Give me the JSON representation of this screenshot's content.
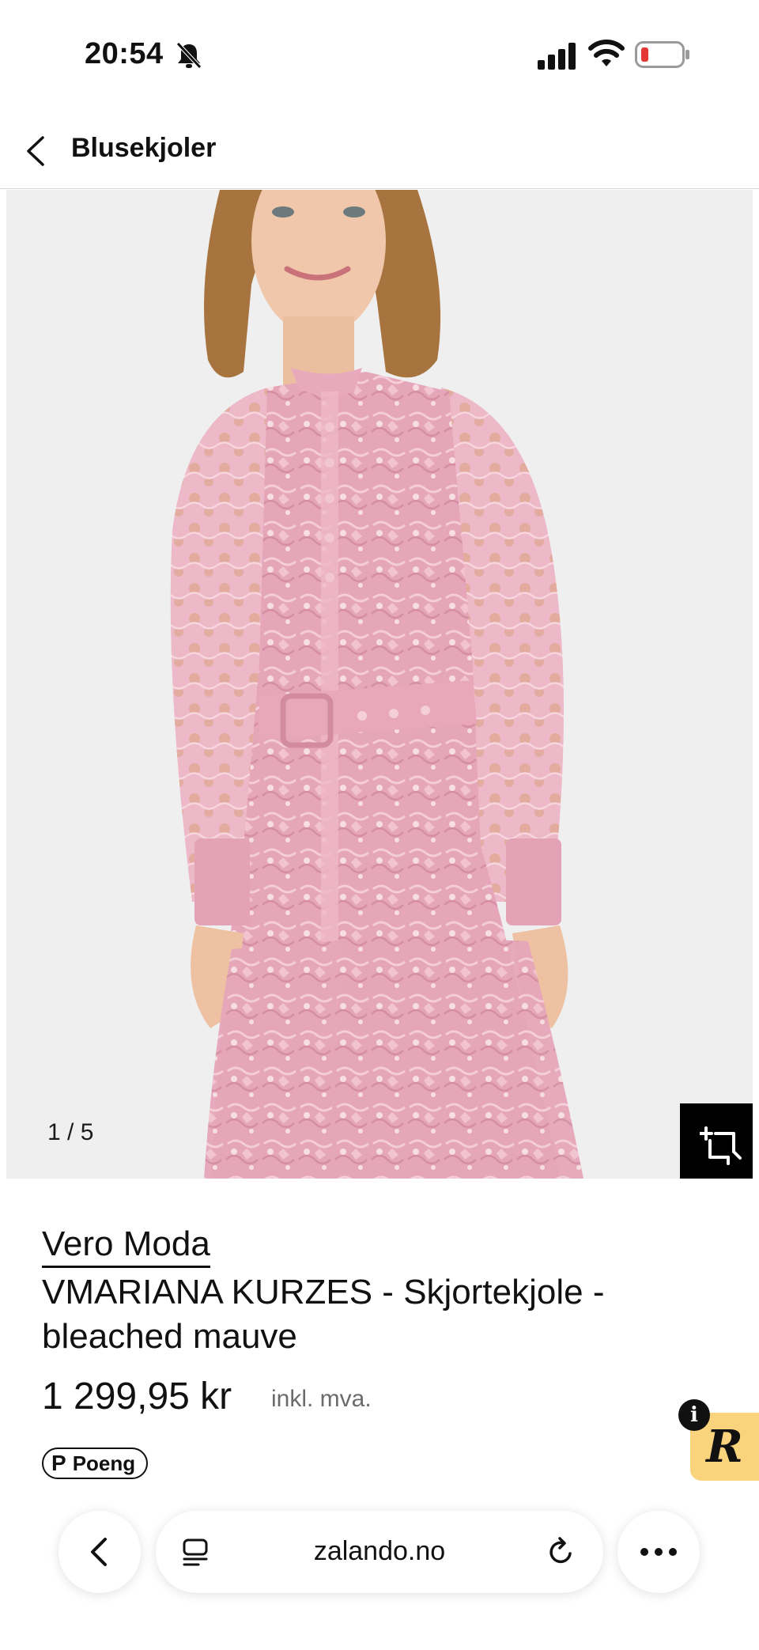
{
  "status_bar": {
    "time": "20:54",
    "icons": [
      "bell-muted-icon",
      "cellular-signal-icon",
      "wifi-icon",
      "battery-low-icon"
    ],
    "battery_color": "#e53935"
  },
  "header": {
    "title": "Blusekjoler",
    "back_icon": "chevron-left-icon"
  },
  "gallery": {
    "counter": "1 / 5",
    "try_on_icon": "crop-add-icon"
  },
  "product": {
    "brand": "Vero Moda",
    "name": "VMARIANA KURZES - Skjortekjole - bleached mauve",
    "price": "1 299,95 kr",
    "vat_note": "inkl. mva.",
    "points_label": "Poeng",
    "points_glyph": "P"
  },
  "floating_badge": {
    "letter": "R",
    "info": "i",
    "color": "#f9d47c"
  },
  "browser": {
    "url": "zalando.no",
    "back_icon": "chevron-left-icon",
    "tabs_icon": "tabs-icon",
    "reload_icon": "reload-icon",
    "more_icon": "more-dots-icon"
  },
  "colors": {
    "dress_pink": "#e8a9bd",
    "background": "#ffffff",
    "text": "#111111",
    "muted_text": "#6b6b6b"
  }
}
